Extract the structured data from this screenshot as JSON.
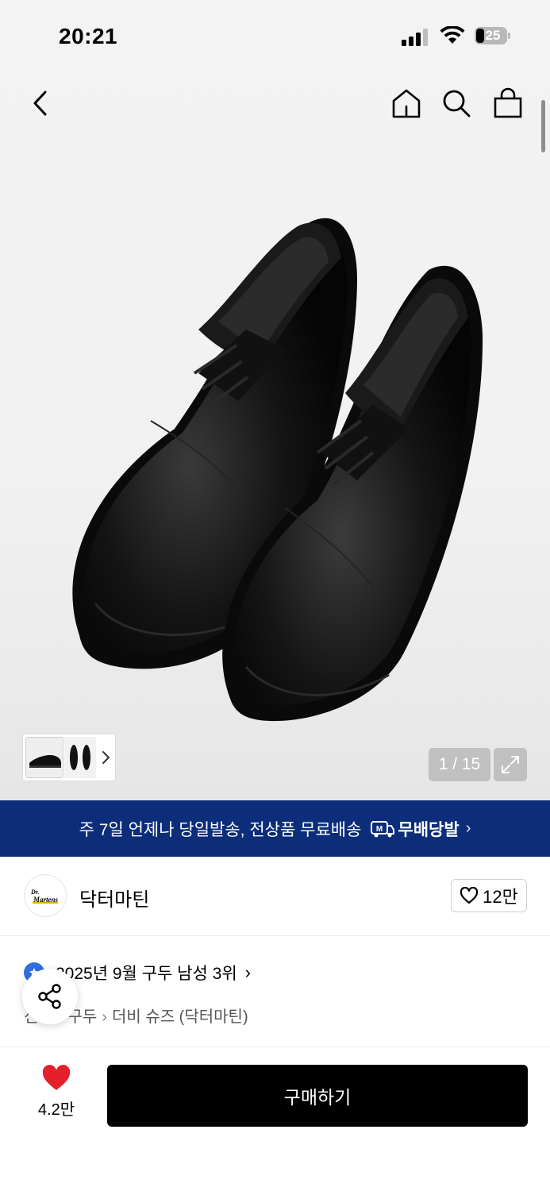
{
  "status_bar": {
    "time": "20:21",
    "battery": "25"
  },
  "gallery": {
    "counter": "1 / 15"
  },
  "banner": {
    "text": "주 7일 언제나 당일발송, 전상품 무료배송",
    "badge": "무배당발",
    "badge_icon_letter": "M"
  },
  "brand": {
    "name": "닥터마틴",
    "likes": "12만"
  },
  "ranking": {
    "text": "2025년 9월 구두 남성 3위"
  },
  "breadcrumb": [
    "신발",
    "구두",
    "더비 슈즈 (닥터마틴)"
  ],
  "bottom_bar": {
    "favorite_count": "4.2만",
    "buy_label": "구매하기"
  },
  "colors": {
    "banner_bg": "#0b2d7a",
    "heart": "#e5202a",
    "rank_badge": "#2f6fe0",
    "buy_bg": "#000000"
  }
}
